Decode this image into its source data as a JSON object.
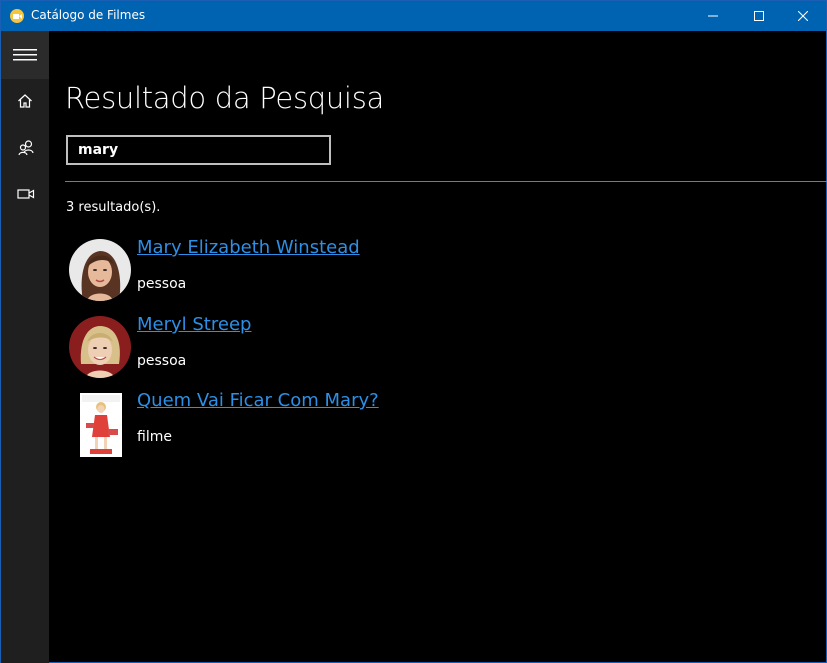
{
  "window": {
    "title": "Catálogo de Filmes",
    "icons": {
      "app": "film-camera-icon",
      "minimize": "minimize-icon",
      "maximize": "maximize-icon",
      "close": "close-icon"
    }
  },
  "nav": {
    "menu_icon": "hamburger-menu-icon",
    "items": [
      {
        "icon": "home-icon"
      },
      {
        "icon": "people-icon"
      },
      {
        "icon": "video-camera-icon"
      }
    ]
  },
  "page": {
    "title": "Resultado da Pesquisa",
    "search": {
      "value": "mary",
      "placeholder": ""
    },
    "result_count": "3 resultado(s)."
  },
  "results": [
    {
      "name": "Mary Elizabeth Winstead",
      "type": "pessoa",
      "image": "person-photo"
    },
    {
      "name": "Meryl Streep",
      "type": "pessoa",
      "image": "person-photo"
    },
    {
      "name": "Quem Vai Ficar Com Mary?",
      "type": "filme",
      "image": "movie-poster"
    }
  ],
  "colors": {
    "titlebar": "#0063b1",
    "link": "#2d8fe5",
    "sidebar": "#1f1f1f",
    "background": "#000000"
  }
}
